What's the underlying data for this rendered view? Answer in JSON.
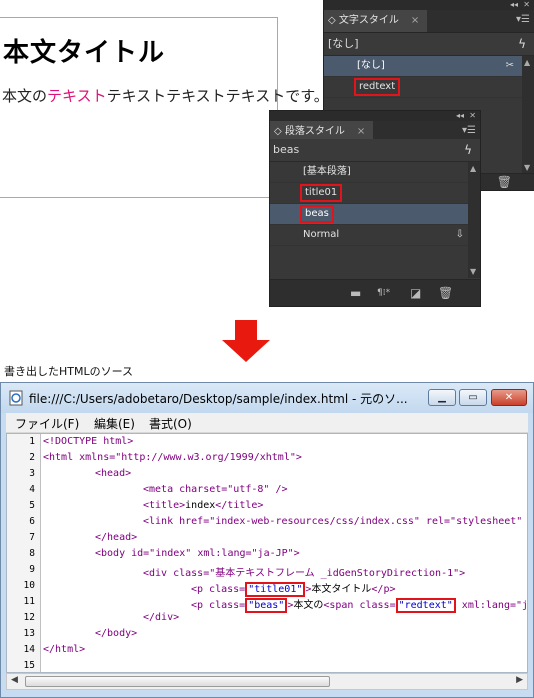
{
  "document": {
    "title": "本文タイトル",
    "body_before": "本文の",
    "body_red": "テキスト",
    "body_after": "テキストテキストテキストです。",
    "red_color": "#e0107a"
  },
  "char_panel": {
    "tab_label": "文字スタイル",
    "current_style": "[なし]",
    "items": [
      {
        "label": "[なし]",
        "selected": false
      },
      {
        "label": "redtext",
        "selected": false
      }
    ]
  },
  "para_panel": {
    "tab_label": "段落スタイル",
    "current_style": "beas",
    "items": [
      {
        "label": "[基本段落]"
      },
      {
        "label": "title01"
      },
      {
        "label": "beas"
      },
      {
        "label": "Normal"
      }
    ]
  },
  "caption": "書き出したHTMLのソース",
  "window": {
    "title": "file:///C:/Users/adobetaro/Desktop/sample/index.html - 元のソ...",
    "menu": [
      "ファイル(F)",
      "編集(E)",
      "書式(O)"
    ],
    "lines": [
      {
        "n": "1"
      },
      {
        "n": "2"
      },
      {
        "n": "3"
      },
      {
        "n": "4"
      },
      {
        "n": "5"
      },
      {
        "n": "6"
      },
      {
        "n": "7"
      },
      {
        "n": "8"
      },
      {
        "n": "9"
      },
      {
        "n": "10"
      },
      {
        "n": "11"
      },
      {
        "n": "12"
      },
      {
        "n": "13"
      },
      {
        "n": "14"
      },
      {
        "n": "15"
      }
    ],
    "code": {
      "l1": "<!DOCTYPE html>",
      "l2": "<html xmlns=\"http://www.w3.org/1999/xhtml\">",
      "l3": "<head>",
      "l4": "<meta charset=\"utf-8\" />",
      "l5a": "<title>",
      "l5b": "index",
      "l5c": "</title>",
      "l6": "<link href=\"index-web-resources/css/index.css\" rel=\"stylesheet\" t",
      "l7": "</head>",
      "l8": "<body id=\"index\" xml:lang=\"ja-JP\">",
      "l9": "<div class=\"基本テキストフレーム _idGenStoryDirection-1\">",
      "l10a": "<p class=",
      "l10b": "\"title01\"",
      "l10c": ">",
      "l10d": "本文タイトル",
      "l10e": "</p>",
      "l11a": "<p class=",
      "l11b": "\"beas\"",
      "l11c": ">",
      "l11d": "本文の",
      "l11e": "<span class=",
      "l11f": "\"redtext\"",
      "l11g": " xml:lang=\"ja-",
      "l12": "</div>",
      "l13": "</body>",
      "l14": "</html>"
    }
  },
  "colors": {
    "highlight_box": "#e0141a",
    "panel_bg": "#383838",
    "selected_row": "#4b5a6d",
    "arrow": "#e8190f"
  }
}
